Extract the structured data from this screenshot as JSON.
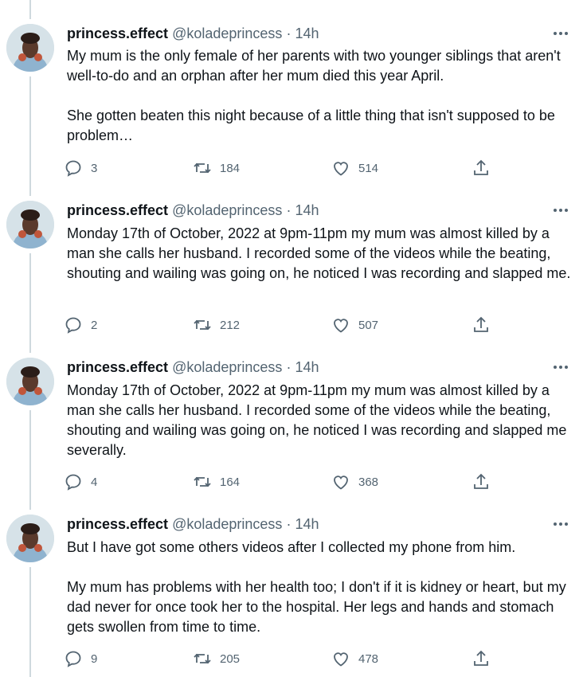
{
  "colors": {
    "text": "#0f1419",
    "secondary": "#536471",
    "thread_line": "#cfd9de"
  },
  "icons": {
    "reply": "reply-icon",
    "retweet": "retweet-icon",
    "like": "heart-icon",
    "share": "share-icon",
    "more": "more-icon"
  },
  "tweets": [
    {
      "name": "princess.effect",
      "handle": "@koladeprincess",
      "separator": "·",
      "time": "14h",
      "text": "My mum is the only female of her parents with two younger siblings that aren't well-to-do and an orphan after her mum died this year April.\n\nShe gotten beaten this night because of a little thing that isn't supposed to be problem…",
      "replies": "3",
      "retweets": "184",
      "likes": "514"
    },
    {
      "name": "princess.effect",
      "handle": "@koladeprincess",
      "separator": "·",
      "time": "14h",
      "text": "Monday 17th of October, 2022 at 9pm-11pm my mum was almost killed by a man she calls her husband. I recorded some of the videos while the beating, shouting and wailing was going on, he noticed I was recording and slapped me.",
      "replies": "2",
      "retweets": "212",
      "likes": "507"
    },
    {
      "name": "princess.effect",
      "handle": "@koladeprincess",
      "separator": "·",
      "time": "14h",
      "text": "Monday 17th of October, 2022 at 9pm-11pm my mum was almost killed by a man she calls her husband. I recorded some of the videos while the beating, shouting and wailing was going on, he noticed I was recording and slapped me severally.",
      "replies": "4",
      "retweets": "164",
      "likes": "368"
    },
    {
      "name": "princess.effect",
      "handle": "@koladeprincess",
      "separator": "·",
      "time": "14h",
      "text": "But I have got some others videos after I collected my phone from him.\n\nMy mum has problems with her health too; I don't if it is kidney or heart, but my dad never for once took her to the hospital. Her legs and hands and stomach gets swollen from time to time.",
      "replies": "9",
      "retweets": "205",
      "likes": "478"
    }
  ]
}
